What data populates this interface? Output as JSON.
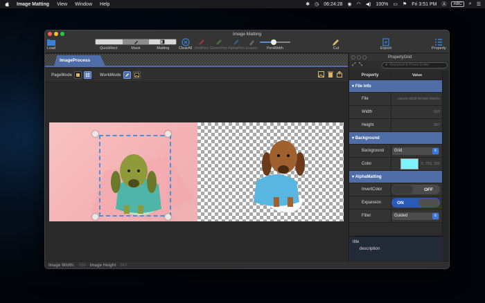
{
  "menubar": {
    "app_name": "Image Matting",
    "menus": [
      "View",
      "Window",
      "Help"
    ],
    "clock_time": "06:24:28",
    "battery": "100%",
    "datetime": "Fri 3:51 PM",
    "input_source": "ABC"
  },
  "window": {
    "title": "Image Matting"
  },
  "toolbar": {
    "load": "Load",
    "quickrect": "QuickRect",
    "mask": "Mask",
    "matting": "Matting",
    "clearall": "ClearAll",
    "redpen": "RedPen",
    "greenpen": "GreenPen",
    "alphapen": "AlphaPen",
    "eraser": "Eraser",
    "penwidth": "PenWidth",
    "penwidth_level": 0.4,
    "cut": "Cut",
    "export": "Export",
    "property": "Property"
  },
  "tabs": {
    "active": "ImageProcess"
  },
  "modebar": {
    "page_mode": "PageMode",
    "work_mode": "WorkMode"
  },
  "status": {
    "width_label": "Image Width:",
    "width_value": "550",
    "height_label": "Image Height",
    "height_value": "367"
  },
  "property_grid": {
    "title": "PropertyGrid",
    "search_placeholder": "Keyword & Press Enter",
    "col_property": "Property",
    "col_value": "Value",
    "file_info": {
      "category": "File Info",
      "file_label": "File",
      "file_value": "canva-adult-brown-dachs",
      "width_label": "Width",
      "width_value": "550",
      "height_label": "Height",
      "height_value": "367"
    },
    "background": {
      "category": "Background",
      "bg_label": "Background",
      "bg_value": "Grid",
      "color_label": "Color",
      "color_value": "0, 250, 255",
      "swatch_color": "#7cf3ff"
    },
    "alpha_matting": {
      "category": "AlphaMatting",
      "invert_label": "InvertColor",
      "invert_state": "OFF",
      "expansion_label": "Expansion",
      "expansion_state": "ON",
      "filter_label": "Filter",
      "filter_value": "Guided"
    },
    "desc_title": "title",
    "desc_text": "description"
  },
  "colors": {
    "accent": "#4f6ea8",
    "selection": "#4a8fd8",
    "toggle_on": "#2a5ab8"
  }
}
